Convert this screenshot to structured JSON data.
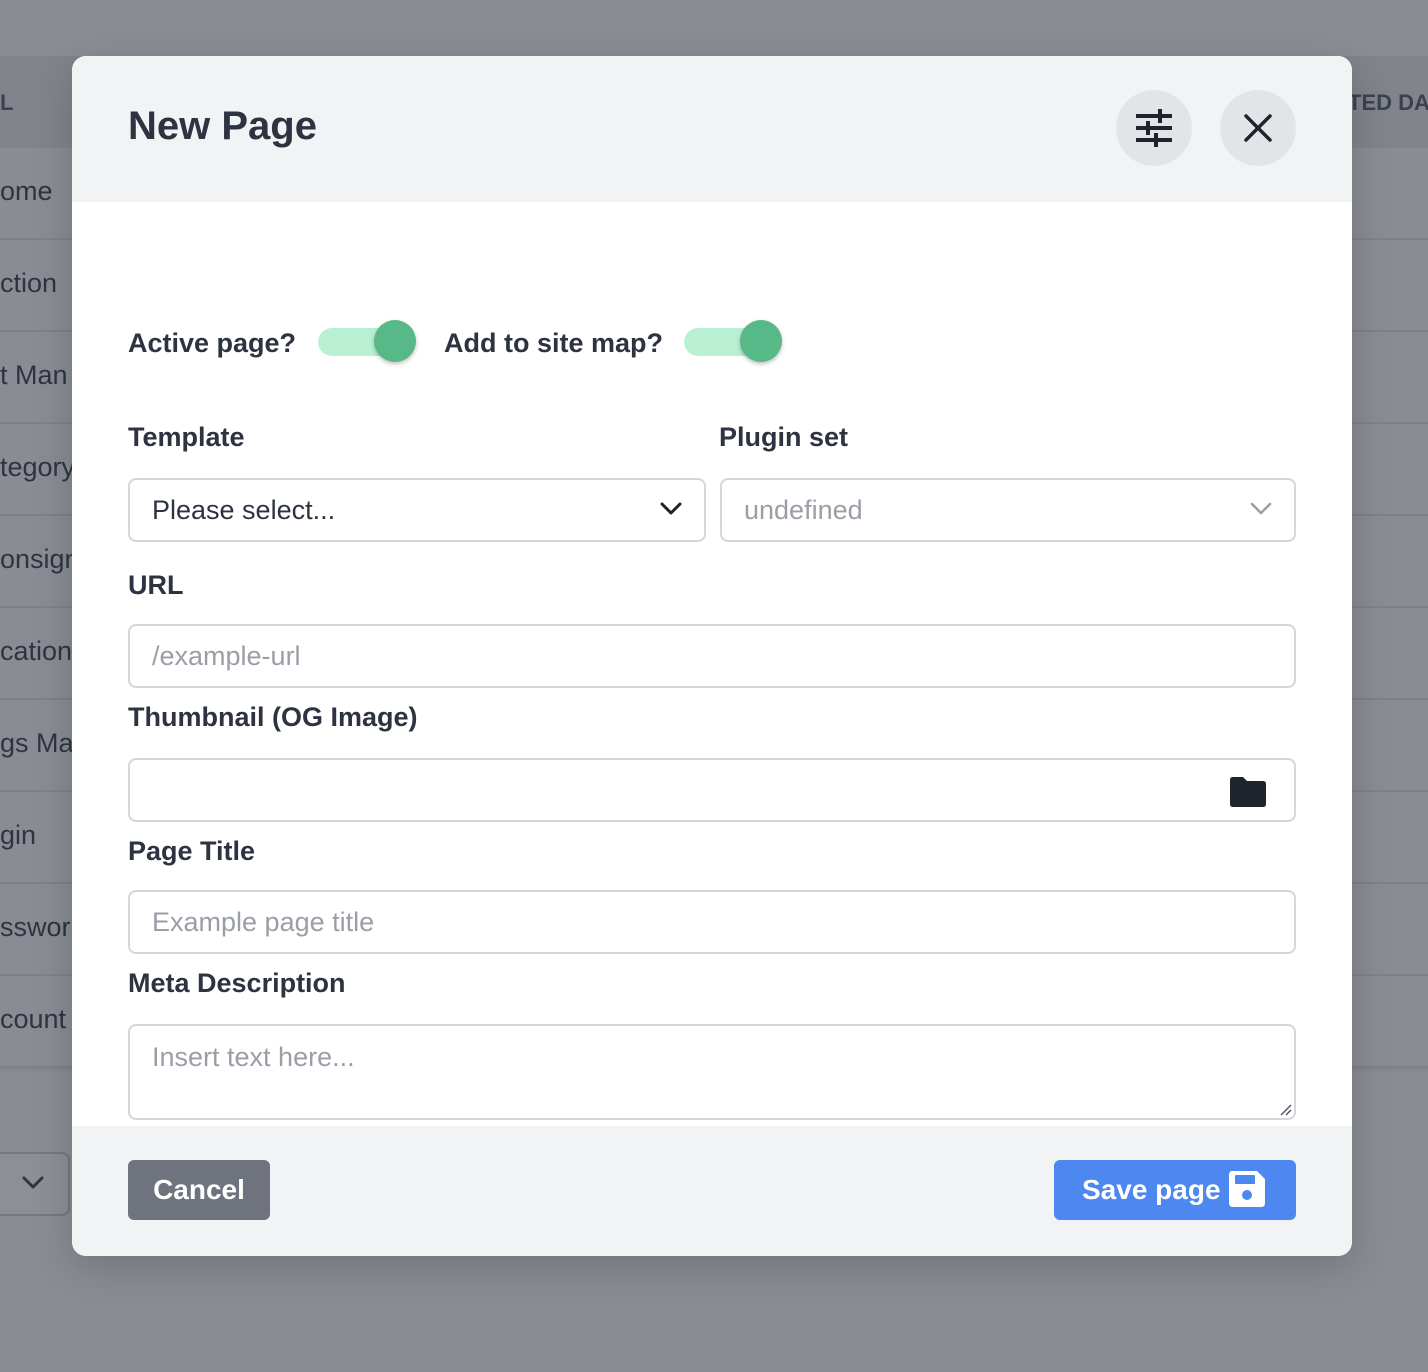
{
  "background": {
    "columns": [
      "L",
      "TED DAT"
    ],
    "rows": [
      "ome",
      "ction",
      "t Man",
      "tegory",
      "onsign",
      "cation",
      "gs Ma",
      "gin",
      "sswor",
      "count"
    ],
    "select_icon": "chevron-down-icon"
  },
  "modal": {
    "title": "New Page",
    "header_icons": [
      "sliders-icon",
      "close-icon"
    ],
    "toggles": {
      "active_page": {
        "label": "Active page?",
        "on": true
      },
      "site_map": {
        "label": "Add to site map?",
        "on": true
      }
    },
    "template": {
      "label": "Template",
      "value": "Please select...",
      "icon": "chevron-down-icon"
    },
    "plugin_set": {
      "label": "Plugin set",
      "value": "undefined",
      "icon": "chevron-down-icon"
    },
    "url": {
      "label": "URL",
      "placeholder": "/example-url",
      "value": ""
    },
    "thumbnail": {
      "label": "Thumbnail (OG Image)",
      "value": "",
      "icon": "folder-icon"
    },
    "page_title": {
      "label": "Page Title",
      "placeholder": "Example page title",
      "value": ""
    },
    "meta_description": {
      "label": "Meta Description",
      "placeholder": "Insert text here...",
      "value": ""
    },
    "footer": {
      "cancel_label": "Cancel",
      "save_label": "Save page",
      "save_icon": "floppy-disk-icon"
    }
  },
  "colors": {
    "toggle_track": "#b9f0d4",
    "toggle_knob": "#56b987",
    "save_button": "#4d87f0",
    "cancel_button": "#6f737e"
  }
}
